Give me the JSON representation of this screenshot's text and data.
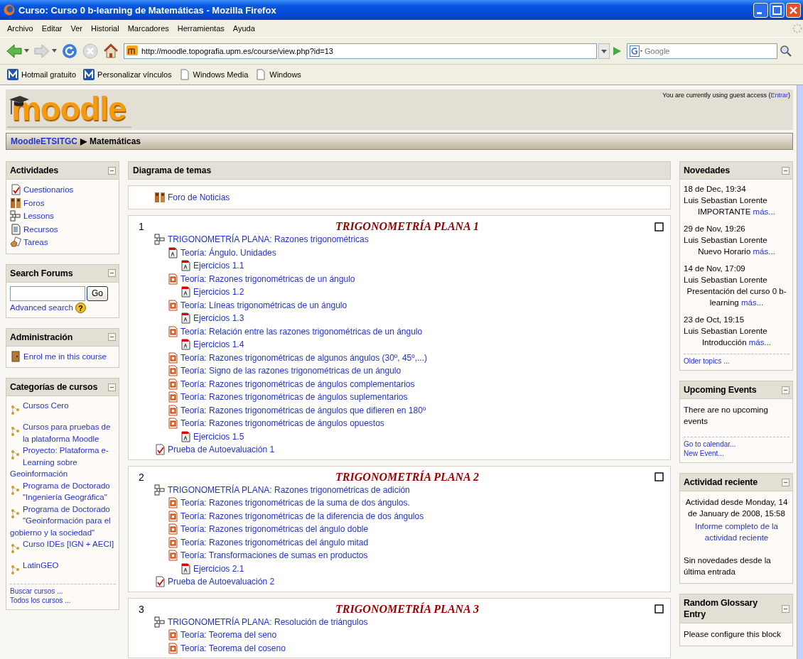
{
  "window": {
    "title": "Curso: Curso 0 b-learning de Matemáticas - Mozilla Firefox"
  },
  "menu": [
    "Archivo",
    "Editar",
    "Ver",
    "Historial",
    "Marcadores",
    "Herramientas",
    "Ayuda"
  ],
  "address": {
    "value": "http://moodle.topografia.upm.es/course/view.php?id=13"
  },
  "web_search": {
    "placeholder": "Google"
  },
  "bookmarks": [
    {
      "kind": "moodle",
      "label": "Hotmail gratuito"
    },
    {
      "kind": "moodle",
      "label": "Personalizar vínculos"
    },
    {
      "kind": "page",
      "label": "Windows Media"
    },
    {
      "kind": "page",
      "label": "Windows"
    }
  ],
  "header": {
    "logo": "moodle",
    "login_prefix": "You are currently using guest access (",
    "login_link": "Entrar",
    "login_suffix": ")"
  },
  "breadcrumb": {
    "home": "MoodleETSITGC",
    "separator": "▶",
    "current": "Matemáticas"
  },
  "left_blocks": [
    {
      "title": "Actividades",
      "items": [
        {
          "kind": "quiz",
          "label": "Cuestionarios"
        },
        {
          "kind": "forum",
          "label": "Foros"
        },
        {
          "kind": "lesson",
          "label": "Lessons"
        },
        {
          "kind": "resource",
          "label": "Recursos"
        },
        {
          "kind": "assignment",
          "label": "Tareas"
        }
      ]
    },
    {
      "title": "Search Forums",
      "search": {
        "button": "Go",
        "link": "Advanced search",
        "help": "?"
      }
    },
    {
      "title": "Administración",
      "items": [
        {
          "kind": "enrol",
          "label": "Enrol me in this course"
        }
      ]
    },
    {
      "title": "Categorías de cursos",
      "items": [
        {
          "kind": "category",
          "label": "Cursos Cero"
        },
        {
          "kind": "category",
          "label": "Cursos para pruebas de la plataforma Moodle"
        },
        {
          "kind": "category",
          "label": "Proyecto: Plataforma e-Learning sobre Geoinformación"
        },
        {
          "kind": "category",
          "label": "Programa de Doctorado \"Ingeniería Geográfica\""
        },
        {
          "kind": "category",
          "label": "Programa de Doctorado \"Geoinformación para el gobierno y la sociedad\""
        },
        {
          "kind": "category",
          "label": "Curso IDEs [IGN + AECI]"
        },
        {
          "kind": "category",
          "label": "LatinGEO"
        }
      ],
      "footer": [
        "Buscar cursos ...",
        "Todos los cursos ..."
      ]
    }
  ],
  "topics": {
    "title": "Diagrama de temas",
    "news_forum": {
      "kind": "forum",
      "label": "Foro de Noticias"
    },
    "sections": [
      {
        "number": "1",
        "title": "TRIGONOMETRÍA PLANA 1",
        "items": [
          {
            "kind": "lesson",
            "label": "TRIGONOMETRÍA PLANA: Razones trigonométricas",
            "children": [
              {
                "kind": "pdf",
                "label": "Teoría: Ángulo. Unidades",
                "children": [
                  {
                    "kind": "pdf",
                    "label": "Ejercicios 1.1"
                  }
                ]
              },
              {
                "kind": "slides",
                "label": "Teoría: Razones trigonométricas de un ángulo",
                "children": [
                  {
                    "kind": "pdf",
                    "label": "Ejercicios 1.2"
                  }
                ]
              },
              {
                "kind": "slides",
                "label": "Teoría: Líneas trigonométricas de un ángulo",
                "children": [
                  {
                    "kind": "pdf",
                    "label": "Ejercicios 1.3"
                  }
                ]
              },
              {
                "kind": "slides",
                "label": "Teoría: Relación entre las razones trigonométricas de un ángulo",
                "children": [
                  {
                    "kind": "pdf",
                    "label": "Ejercicios 1.4"
                  }
                ]
              },
              {
                "kind": "slides",
                "label": "Teoría: Razones trigonométricas de algunos ángulos (30º, 45º,...)"
              },
              {
                "kind": "slides",
                "label": "Teoría: Signo de las razones trigonométricas de un ángulo"
              },
              {
                "kind": "slides",
                "label": "Teoría: Razones trigonométricas de ángulos complementarios"
              },
              {
                "kind": "slides",
                "label": "Teoría: Razones trigonométricas de ángulos suplementarios"
              },
              {
                "kind": "slides",
                "label": "Teoría: Razones trigonométricas de ángulos que difieren en 180º"
              },
              {
                "kind": "slides",
                "label": "Teoría: Razones trigonométricas de ángulos opuestos",
                "children": [
                  {
                    "kind": "pdf",
                    "label": "Ejercicios 1.5"
                  }
                ]
              }
            ]
          },
          {
            "kind": "quiz",
            "label": "Prueba de Autoevaluación 1"
          }
        ]
      },
      {
        "number": "2",
        "title": "TRIGONOMETRÍA PLANA 2",
        "items": [
          {
            "kind": "lesson",
            "label": "TRIGONOMETRÍA PLANA: Razones trigonométricas de adición",
            "children": [
              {
                "kind": "slides",
                "label": "Teoría: Razones trigonométricas de la suma de dos ángulos."
              },
              {
                "kind": "slides",
                "label": "Teoría: Razones trigonométricas de la diferencia de dos ángulos"
              },
              {
                "kind": "slides",
                "label": "Teoría: Razones trigonométricas del ángulo doble"
              },
              {
                "kind": "slides",
                "label": "Teoría: Razones trigonométricas del ángulo mitad"
              },
              {
                "kind": "slides",
                "label": "Teoría: Transformaciones de sumas en productos",
                "children": [
                  {
                    "kind": "pdf",
                    "label": "Ejercicios 2.1"
                  }
                ]
              }
            ]
          },
          {
            "kind": "quiz",
            "label": "Prueba de Autoevaluación 2"
          }
        ]
      },
      {
        "number": "3",
        "title": "TRIGONOMETRÍA PLANA 3",
        "items": [
          {
            "kind": "lesson",
            "label": "TRIGONOMETRÍA PLANA: Resolución de triángulos",
            "children": [
              {
                "kind": "slides",
                "label": "Teoría: Teorema del seno"
              },
              {
                "kind": "slides",
                "label": "Teoría: Teorema del coseno"
              }
            ]
          }
        ]
      }
    ]
  },
  "right_blocks": [
    {
      "title": "Novedades",
      "posts": [
        {
          "date": "18 de Dec, 19:34",
          "author": "Luis Sebastian Lorente",
          "subject": "IMPORTANTE",
          "more": "más..."
        },
        {
          "date": "29 de Nov, 19:26",
          "author": "Luis Sebastian Lorente",
          "subject": "Nuevo Horario",
          "more": "más..."
        },
        {
          "date": "14 de Nov, 17:09",
          "author": "Luis Sebastian Lorente",
          "subject": "Presentación del curso 0 b-learning",
          "more": "más..."
        },
        {
          "date": "23 de Oct, 19:15",
          "author": "Luis Sebastian Lorente",
          "subject": "Introducción",
          "more": "más..."
        }
      ],
      "footer": [
        "Older topics ..."
      ]
    },
    {
      "title": "Upcoming Events",
      "texts": [
        {
          "kind": "plain",
          "text": "There are no upcoming events"
        }
      ],
      "footer": [
        "Go to calendar...",
        "New Event..."
      ]
    },
    {
      "title": "Actividad reciente",
      "texts": [
        {
          "kind": "centered",
          "text": "Actividad desde Monday, 14 de January de 2008, 15:58"
        },
        {
          "kind": "link",
          "text": "Informe completo de la actividad reciente"
        },
        {
          "kind": "plain",
          "text": "Sin novedades desde la última entrada"
        }
      ]
    },
    {
      "title": "Random Glossary Entry",
      "texts": [
        {
          "kind": "plain",
          "text": "Please configure this block"
        }
      ]
    }
  ]
}
